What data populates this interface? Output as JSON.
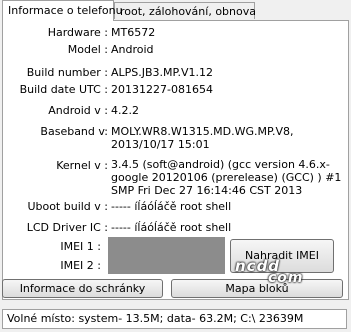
{
  "tabs": [
    {
      "label": "Informace o telefonu"
    },
    {
      "label": "root, zálohování, obnova"
    }
  ],
  "info": {
    "hardware": {
      "label": "Hardware :",
      "value": "MT6572"
    },
    "model": {
      "label": "Model :",
      "value": "Android"
    },
    "build_number": {
      "label": "Build number :",
      "value": "ALPS.JB3.MP.V1.12"
    },
    "build_date": {
      "label": "Build date UTC :",
      "value": "20131227-081654"
    },
    "android": {
      "label": "Android  v :",
      "value": "4.2.2"
    },
    "baseband": {
      "label": "Baseband v:",
      "value": "MOLY.WR8.W1315.MD.WG.MP.V8, 2013/10/17 15:01"
    },
    "kernel": {
      "label": "Kernel v :",
      "value": "3.4.5 (soft@android) (gcc version 4.6.x-google 20120106 (prerelease) (GCC) ) #1 SMP  Fri Dec 27 16:14:46 CST 2013"
    },
    "uboot": {
      "label": "Uboot build v :",
      "value": "----- íĺáóĺáčě   root shell"
    },
    "lcd": {
      "label": "LCD Driver IC :",
      "value": "----- íĺáóĺáčě   root shell"
    },
    "imei1": {
      "label": "IMEI 1 :"
    },
    "imei2": {
      "label": "IMEI 2 :"
    }
  },
  "buttons": {
    "replace_imei": "Nahradit IMEI",
    "copy_info": "Informace do schránky",
    "map": "Mapa bloků"
  },
  "watermark": {
    "line1": "ncdd",
    "line2": "com"
  },
  "status": {
    "free_space": "Volné místo: system- 13.5M; data- 63.2M;  C:\\ 23639M"
  }
}
